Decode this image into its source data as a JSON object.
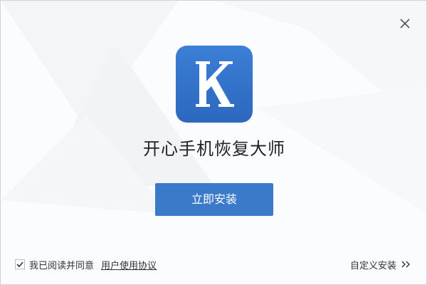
{
  "window": {
    "close_icon": "close-icon"
  },
  "app": {
    "logo_icon": "app-k-logo-icon",
    "title": "开心手机恢复大师",
    "brand_color": "#3b79c9"
  },
  "install": {
    "button_label": "立即安装"
  },
  "agreement": {
    "checked": true,
    "text": "我已阅读并同意",
    "link_text": "用户使用协议"
  },
  "custom": {
    "label": "自定义安装",
    "icon": "double-chevron-right-icon"
  }
}
